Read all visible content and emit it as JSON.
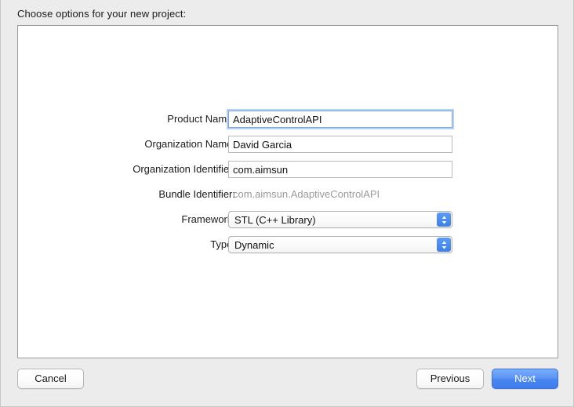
{
  "window": {
    "prompt": "Choose options for your new project:",
    "background_color": "#ececec",
    "panel_background": "#ffffff"
  },
  "form": {
    "rows": [
      {
        "label": "Product Name:",
        "type": "text",
        "value": "AdaptiveControlAPI",
        "placeholder": "",
        "focused": true
      },
      {
        "label": "Organization Name:",
        "type": "text",
        "value": "David Garcia",
        "placeholder": "",
        "focused": false
      },
      {
        "label": "Organization Identifier:",
        "type": "text",
        "value": "com.aimsun",
        "placeholder": "",
        "focused": false
      },
      {
        "label": "Bundle Identifier:",
        "type": "static",
        "value": "com.aimsun.AdaptiveControlAPI"
      },
      {
        "label": "Framework:",
        "type": "popup",
        "value": "STL (C++ Library)"
      },
      {
        "label": "Type:",
        "type": "popup",
        "value": "Dynamic"
      }
    ]
  },
  "buttons": {
    "cancel": "Cancel",
    "previous": "Previous",
    "next": "Next"
  },
  "colors": {
    "accent_blue": "#4a86f0",
    "popup_button_blue": "#3c7fe8",
    "focus_ring": "#b9d0ef",
    "disabled_text": "#9a9a9a"
  }
}
